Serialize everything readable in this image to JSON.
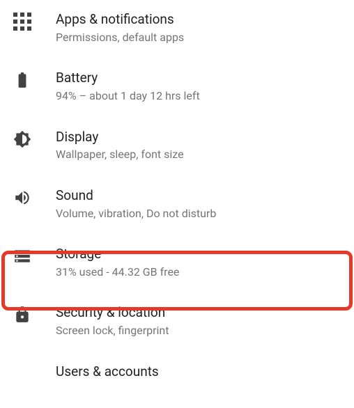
{
  "highlight_color": "#e53a2a",
  "settings": {
    "items": [
      {
        "icon": "apps-grid-icon",
        "title": "Apps & notifications",
        "subtitle": "Permissions, default apps"
      },
      {
        "icon": "battery-icon",
        "title": "Battery",
        "subtitle": "94% – about 1 day 12 hrs left"
      },
      {
        "icon": "brightness-icon",
        "title": "Display",
        "subtitle": "Wallpaper, sleep, font size"
      },
      {
        "icon": "volume-icon",
        "title": "Sound",
        "subtitle": "Volume, vibration, Do not disturb"
      },
      {
        "icon": "storage-icon",
        "title": "Storage",
        "subtitle": "31% used - 44.32 GB free",
        "highlighted": true
      },
      {
        "icon": "lock-icon",
        "title": "Security & location",
        "subtitle": "Screen lock, fingerprint"
      },
      {
        "icon": "person-icon",
        "title": "Users & accounts",
        "subtitle": "",
        "partial": true
      }
    ]
  }
}
